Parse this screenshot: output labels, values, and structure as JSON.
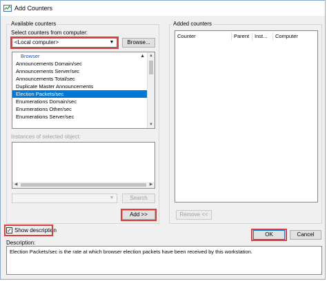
{
  "window": {
    "title": "Add Counters",
    "title_icon": "performance-monitor-icon"
  },
  "available": {
    "section_label": "Available counters",
    "select_label": "Select counters from computer:",
    "computer_value": "<Local computer>",
    "browse_label": "Browse...",
    "group_header": "Browser",
    "counters": [
      "Announcements Domain/sec",
      "Announcements Server/sec",
      "Announcements Total/sec",
      "Duplicate Master Announcements",
      "Election Packets/sec",
      "Enumerations Domain/sec",
      "Enumerations Other/sec",
      "Enumerations Server/sec"
    ],
    "selected_counter": "Election Packets/sec",
    "instances_label": "Instances of selected object:",
    "search_label": "Search",
    "add_label": "Add >>"
  },
  "added": {
    "section_label": "Added counters",
    "columns": [
      "Counter",
      "Parent",
      "Inst...",
      "Computer"
    ],
    "remove_label": "Remove <<"
  },
  "footer": {
    "show_description_label": "Show description",
    "show_description_checked": true,
    "ok_label": "OK",
    "cancel_label": "Cancel",
    "description_label": "Description:",
    "description_text": "Election Packets/sec is the rate at which browser election packets have been received by this workstation."
  },
  "colors": {
    "highlight": "#e03a3a",
    "selection": "#0078d7",
    "header_text": "#1f4e99"
  }
}
